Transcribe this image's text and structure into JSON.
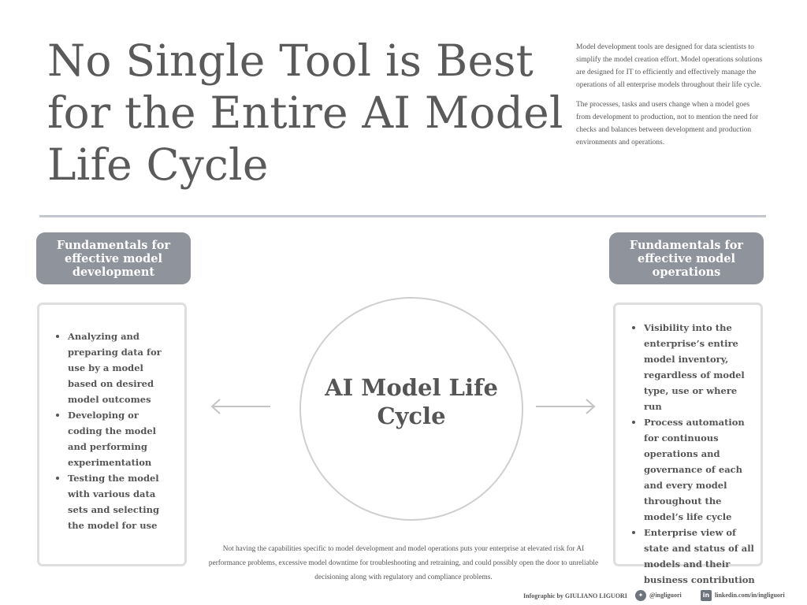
{
  "title": "No Single Tool is Best for the Entire AI Model Life Cycle",
  "intro": {
    "paragraphs": [
      "Model development tools are designed for data scientists to simplify the model creation effort. Model operations solutions are designed for IT to efficiently and effectively manage the operations of all enterprise models throughout their life cycle.",
      "The processes, tasks and users change when a model goes from development to production, not to mention the need for checks and balances between development and production environments and operations."
    ]
  },
  "development": {
    "heading": "Fundamentals for effective model development",
    "items": [
      "Analyzing and preparing data for use by a model based on desired model outcomes",
      "Developing or coding the model and performing experimentation",
      "Testing the model with various data sets and selecting the model for use"
    ]
  },
  "operations": {
    "heading": "Fundamentals for effective model operations",
    "items": [
      "Visibility into the enterprise’s entire model inventory, regardless of model type, use or where run",
      "Process automation for continuous operations and governance of each and every model throughout the model’s life cycle",
      "Enterprise view of state and status of all models and their business contribution"
    ]
  },
  "center_label": "AI Model Life Cycle",
  "footnote": "Not having the capabilities specific to model development and model operations puts your enterprise at elevated risk for AI performance problems, excessive model downtime for troubleshooting and retraining, and could possibly open the door to unreliable decisioning along with regulatory and compliance problems.",
  "footer": {
    "credit": "Infographic by GIULIANO LIGUORI",
    "twitter": "@ingliguori",
    "linkedin": "linkedin.com/in/ingliguori"
  },
  "icons": {
    "twitter": "twitter-icon",
    "linkedin": "linkedin-icon",
    "arrow_left": "arrow-left-icon",
    "arrow_right": "arrow-right-icon"
  },
  "colors": {
    "heading_fill": "#8e939c",
    "text": "#555555",
    "divider": "#c3c7cd",
    "card_border": "#dedede"
  }
}
